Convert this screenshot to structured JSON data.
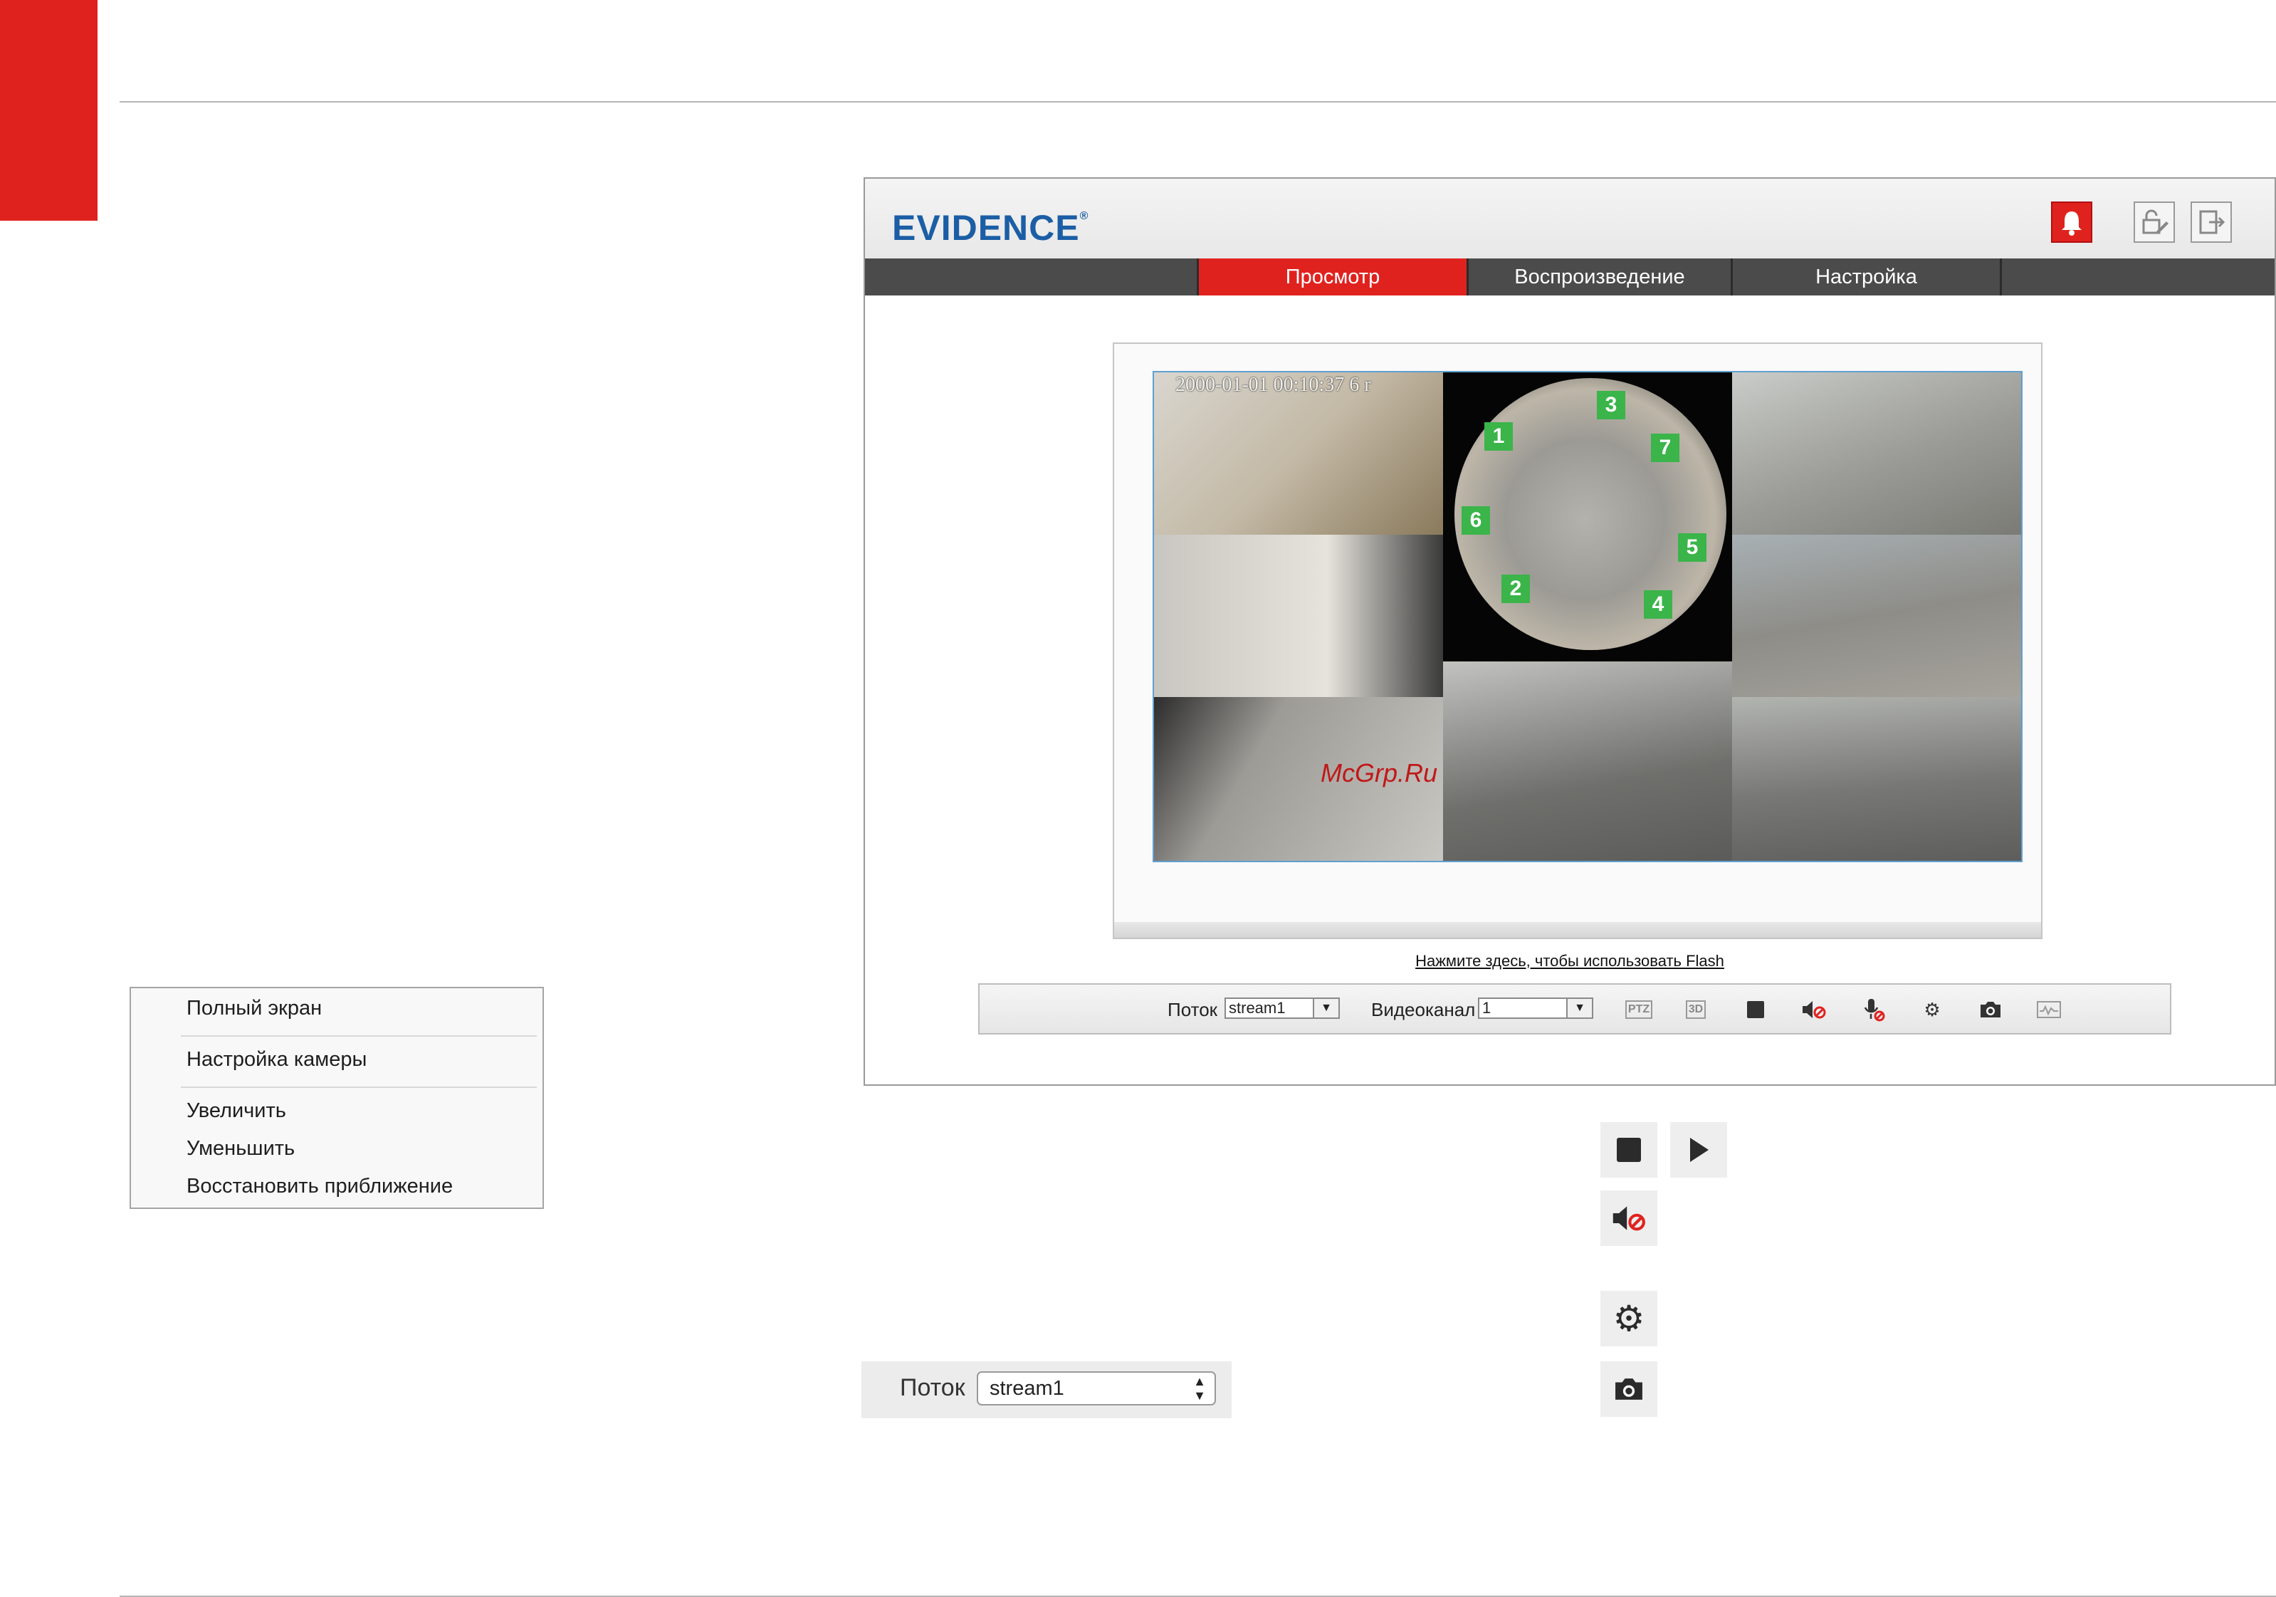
{
  "context_menu": {
    "items": [
      "Полный экран",
      "Настройка камеры",
      "Увеличить",
      "Уменьшить",
      "Восстановить приближение"
    ]
  },
  "app": {
    "logo": "EVIDENCE",
    "logo_mark": "®",
    "header_icons": [
      "alarm-bell-icon",
      "lock-edit-icon",
      "logout-icon"
    ],
    "colors": {
      "accent": "#e0221f",
      "logo_blue": "#1b5ea5",
      "nav_bg": "#4b4b4b",
      "badge_green": "#3bb44a"
    },
    "tabs": [
      {
        "label": "Просмотр",
        "active": true
      },
      {
        "label": "Воспроизведение",
        "active": false
      },
      {
        "label": "Настройка",
        "active": false
      }
    ],
    "video": {
      "osd_text": "2000-01-01 00:10:37  6 r",
      "region_badges": [
        "1",
        "3",
        "7",
        "6",
        "5",
        "2",
        "4"
      ]
    },
    "watermark": "McGrp.Ru",
    "flash_link": "Нажмите здесь, чтобы использовать Flash",
    "controls": {
      "stream_label": "Поток",
      "stream_value": "stream1",
      "channel_label": "Видеоканал",
      "channel_value": "1",
      "ptz_label": "PTZ",
      "threed_label": "3D",
      "icons": [
        "stop-icon",
        "mute-icon",
        "mic-mute-icon",
        "gear-icon",
        "camera-icon",
        "waveform-icon"
      ]
    }
  },
  "standalone": {
    "icons": [
      "stop-icon",
      "play-icon",
      "mute-icon",
      "gear-icon",
      "camera-icon"
    ],
    "stream_label": "Поток",
    "stream_value": "stream1"
  }
}
